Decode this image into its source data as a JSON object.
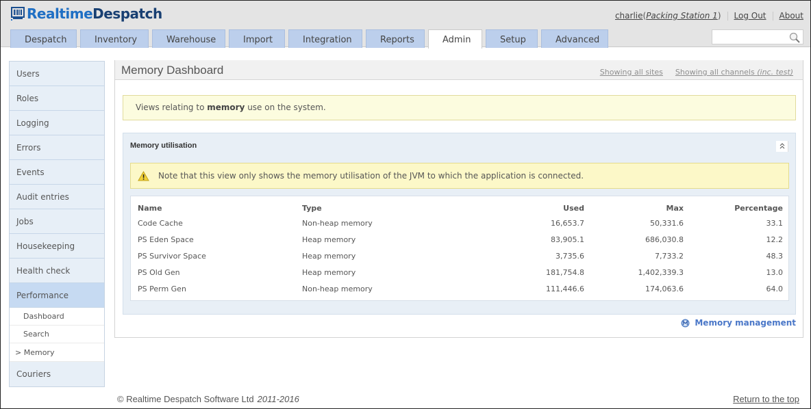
{
  "app": {
    "brand_part1": "Realtime",
    "brand_part2": "Despatch"
  },
  "user": {
    "name": "charlie",
    "open_paren": " (",
    "station": "Packing Station 1",
    "close_paren": ")",
    "logout": "Log Out",
    "about": "About"
  },
  "tabs": [
    {
      "label": "Despatch",
      "active": false
    },
    {
      "label": "Inventory",
      "active": false
    },
    {
      "label": "Warehouse",
      "active": false
    },
    {
      "label": "Import",
      "active": false
    },
    {
      "label": "Integration",
      "active": false
    },
    {
      "label": "Reports",
      "active": false
    },
    {
      "label": "Admin",
      "active": true
    },
    {
      "label": "Setup",
      "active": false
    },
    {
      "label": "Advanced",
      "active": false
    }
  ],
  "search": {
    "value": "",
    "placeholder": ""
  },
  "sidebar": {
    "items": [
      {
        "label": "Users"
      },
      {
        "label": "Roles"
      },
      {
        "label": "Logging"
      },
      {
        "label": "Errors"
      },
      {
        "label": "Events"
      },
      {
        "label": "Audit entries"
      },
      {
        "label": "Jobs"
      },
      {
        "label": "Housekeeping"
      },
      {
        "label": "Health check"
      },
      {
        "label": "Performance"
      }
    ],
    "sub_items": [
      {
        "label": "Dashboard"
      },
      {
        "label": "Search"
      },
      {
        "label": "Memory",
        "marker": ">"
      }
    ],
    "after_items": [
      {
        "label": "Couriers"
      }
    ]
  },
  "main": {
    "title": "Memory Dashboard",
    "filter_sites": "Showing all sites",
    "filter_channels": "Showing all channels ",
    "filter_channels_suffix": "(inc. test)",
    "info_prefix": "Views relating to ",
    "info_bold": "memory",
    "info_suffix": " use on the system.",
    "section": {
      "title": "Memory utilisation",
      "collapse_glyph": "⌃",
      "warning": "Note that this view only shows the memory utilisation of the JVM to which the application is connected.",
      "table": {
        "headers": [
          "Name",
          "Type",
          "Used",
          "Max",
          "Percentage"
        ],
        "rows": [
          [
            "Code Cache",
            "Non-heap memory",
            "16,653.7",
            "50,331.6",
            "33.1"
          ],
          [
            "PS Eden Space",
            "Heap memory",
            "83,905.1",
            "686,030.8",
            "12.2"
          ],
          [
            "PS Survivor Space",
            "Heap memory",
            "3,735.6",
            "7,733.2",
            "48.3"
          ],
          [
            "PS Old Gen",
            "Heap memory",
            "181,754.8",
            "1,402,339.3",
            "13.0"
          ],
          [
            "PS Perm Gen",
            "Non-heap memory",
            "111,446.6",
            "174,063.6",
            "64.0"
          ]
        ]
      }
    },
    "memory_management_link": "Memory management"
  },
  "footer": {
    "copyright": "© Realtime Despatch Software Ltd",
    "years": "2011-2016",
    "return_top": "Return to the top"
  },
  "colors": {
    "brand_light": "#1f6fc4",
    "brand_dark": "#183f72",
    "tab_bg": "#bccfec",
    "sidebar_active": "#c6daf2",
    "link_blue": "#4a77c8"
  }
}
